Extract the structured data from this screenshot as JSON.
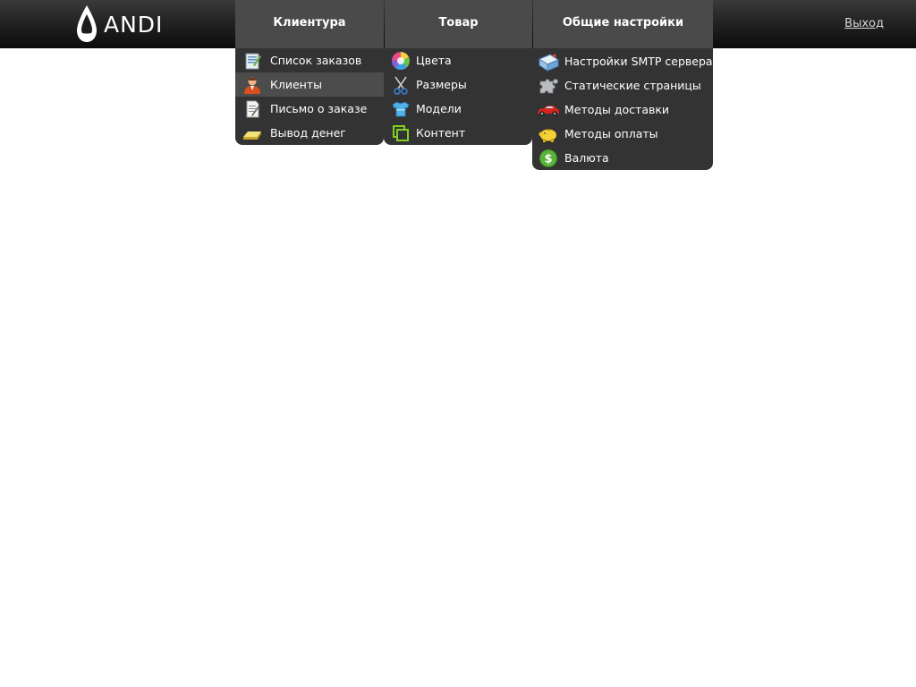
{
  "brand": {
    "logo_text": "ANDI"
  },
  "nav": {
    "tabs": [
      {
        "label": "Клиентура"
      },
      {
        "label": "Товар"
      },
      {
        "label": "Общие настройки"
      }
    ]
  },
  "header": {
    "logout_label": "Выход"
  },
  "menus": {
    "clients": {
      "items": [
        {
          "label": "Список заказов",
          "icon": "order-list-icon",
          "active": false
        },
        {
          "label": "Клиенты",
          "icon": "client-person-icon",
          "active": true
        },
        {
          "label": "Письмо о заказе",
          "icon": "letter-document-icon",
          "active": false
        },
        {
          "label": "Вывод денег",
          "icon": "gold-bar-icon",
          "active": false
        }
      ]
    },
    "goods": {
      "items": [
        {
          "label": "Цвета",
          "icon": "color-wheel-icon"
        },
        {
          "label": "Размеры",
          "icon": "scissors-icon"
        },
        {
          "label": "Модели",
          "icon": "tshirt-icon"
        },
        {
          "label": "Контент",
          "icon": "content-copy-icon"
        }
      ]
    },
    "settings": {
      "items": [
        {
          "label": "Настройки SMTP сервера",
          "icon": "smtp-mail-icon"
        },
        {
          "label": "Статические страницы",
          "icon": "puzzle-icon"
        },
        {
          "label": "Методы доставки",
          "icon": "red-car-icon"
        },
        {
          "label": "Методы оплаты",
          "icon": "piggy-bank-icon"
        },
        {
          "label": "Валюта",
          "icon": "dollar-coin-icon"
        }
      ]
    }
  },
  "colors": {
    "topbar": "#1a1a1a",
    "tab": "#4a4a4a",
    "dropdown": "#333333",
    "active_item": "#4c4c4c"
  }
}
